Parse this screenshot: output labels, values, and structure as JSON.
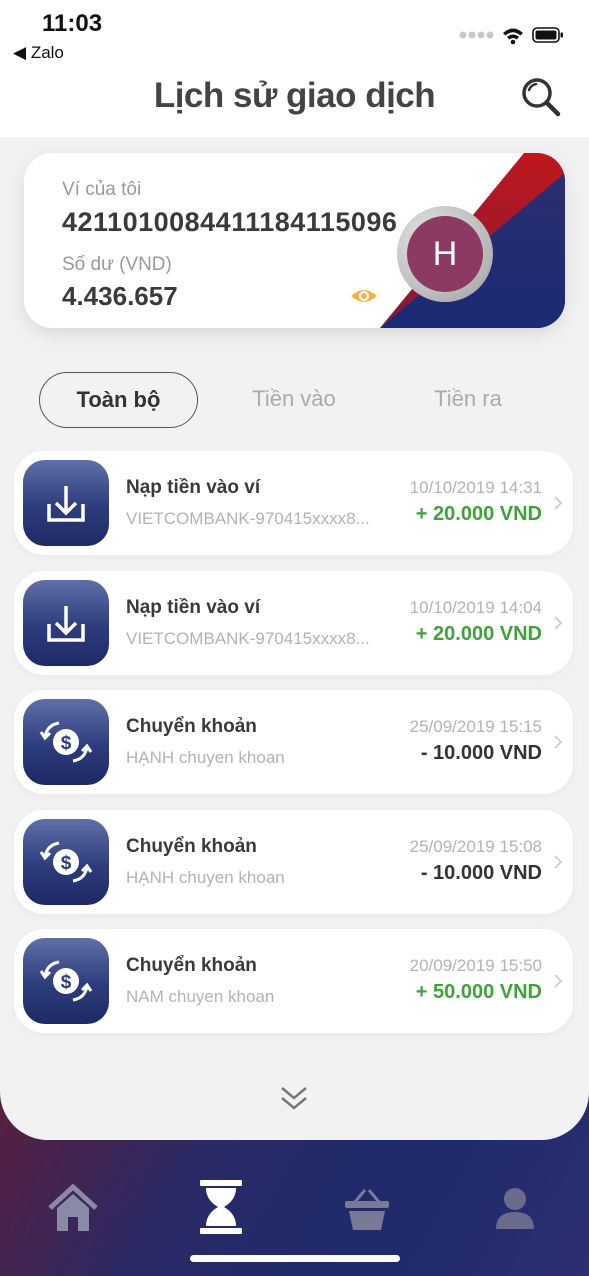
{
  "status_bar": {
    "time": "11:03",
    "back_app": "Zalo"
  },
  "header": {
    "title": "Lịch sử giao dịch"
  },
  "wallet": {
    "label": "Ví của tôi",
    "number": "42110100844111841150​96",
    "balance_label": "Số dư (VND)",
    "balance": "4.436.657",
    "avatar_initial": "H",
    "colors": {
      "red": "#b11d22",
      "navy": "#1c2a6d",
      "avatar": "#8c3a63"
    }
  },
  "tabs": [
    {
      "label": "Toàn bộ",
      "active": true
    },
    {
      "label": "Tiền vào",
      "active": false
    },
    {
      "label": "Tiền ra",
      "active": false
    }
  ],
  "transactions": [
    {
      "icon": "download-icon",
      "title": "Nạp tiền vào ví",
      "desc": "VIETCOMBANK-970415xxxx8...",
      "time": "10/10/2019 14:31",
      "amount": "+ 20.000 VND",
      "direction": "in"
    },
    {
      "icon": "download-icon",
      "title": "Nạp tiền vào ví",
      "desc": "VIETCOMBANK-970415xxxx8...",
      "time": "10/10/2019 14:04",
      "amount": "+ 20.000 VND",
      "direction": "in"
    },
    {
      "icon": "transfer-icon",
      "title": "Chuyển khoản",
      "desc": "HẠNH chuyen khoan",
      "time": "25/09/2019 15:15",
      "amount": "- 10.000 VND",
      "direction": "out"
    },
    {
      "icon": "transfer-icon",
      "title": "Chuyển khoản",
      "desc": "HẠNH chuyen khoan",
      "time": "25/09/2019 15:08",
      "amount": "- 10.000 VND",
      "direction": "out"
    },
    {
      "icon": "transfer-icon",
      "title": "Chuyển khoản",
      "desc": "NAM chuyen khoan",
      "time": "20/09/2019 15:50",
      "amount": "+ 50.000 VND",
      "direction": "in"
    }
  ],
  "nav": [
    {
      "name": "home-icon",
      "active": false
    },
    {
      "name": "hourglass-icon",
      "active": true
    },
    {
      "name": "basket-icon",
      "active": false
    },
    {
      "name": "profile-icon",
      "active": false
    }
  ],
  "colors": {
    "income": "#3fa33a",
    "expense": "#333333",
    "accent_navy": "#2d3c7c"
  }
}
